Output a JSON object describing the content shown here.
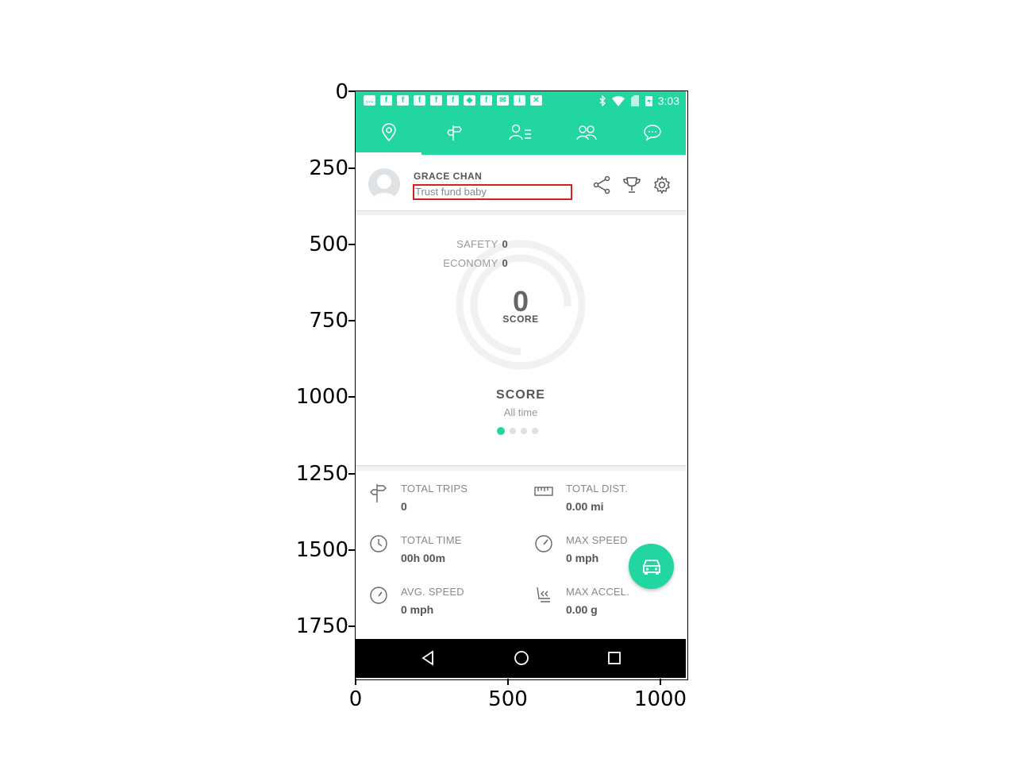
{
  "axes": {
    "y_ticks": [
      "0",
      "250",
      "500",
      "750",
      "1000",
      "1250",
      "1500",
      "1750"
    ],
    "x_ticks": [
      "0",
      "500",
      "1000"
    ]
  },
  "status_bar": {
    "time": "3:03",
    "notification_icons": [
      "message-icon",
      "facebook-icon",
      "facebook-icon",
      "facebook-icon",
      "facebook-icon",
      "facebook-icon",
      "shield-icon",
      "facebook-icon",
      "mail-icon",
      "info-icon",
      "satellite-icon"
    ],
    "system_icons": [
      "bluetooth-icon",
      "wifi-icon",
      "no-sim-icon",
      "battery-charging-icon"
    ]
  },
  "tabs": [
    {
      "name": "location-pin-icon",
      "active": true
    },
    {
      "name": "signpost-icon",
      "active": false
    },
    {
      "name": "user-list-icon",
      "active": false
    },
    {
      "name": "group-icon",
      "active": false
    },
    {
      "name": "chat-icon",
      "active": false
    }
  ],
  "profile": {
    "name": "GRACE CHAN",
    "tagline": "Trust fund baby"
  },
  "score": {
    "safety_label": "SAFETY",
    "safety_value": "0",
    "economy_label": "ECONOMY",
    "economy_value": "0",
    "big_value": "0",
    "big_caption": "SCORE",
    "title": "SCORE",
    "subtitle": "All time",
    "pager_count": 4,
    "pager_active": 0
  },
  "stats": {
    "total_trips": {
      "label": "TOTAL TRIPS",
      "value": "0"
    },
    "total_dist": {
      "label": "TOTAL DIST.",
      "value": "0.00 mi"
    },
    "total_time": {
      "label": "TOTAL TIME",
      "value": "00h 00m"
    },
    "max_speed": {
      "label": "MAX SPEED",
      "value": "0 mph"
    },
    "avg_speed": {
      "label": "AVG. SPEED",
      "value": "0 mph"
    },
    "max_accel": {
      "label": "MAX ACCEL.",
      "value": "0.00 g"
    }
  },
  "colors": {
    "accent": "#21d6a0",
    "highlight_box": "#d62020"
  }
}
